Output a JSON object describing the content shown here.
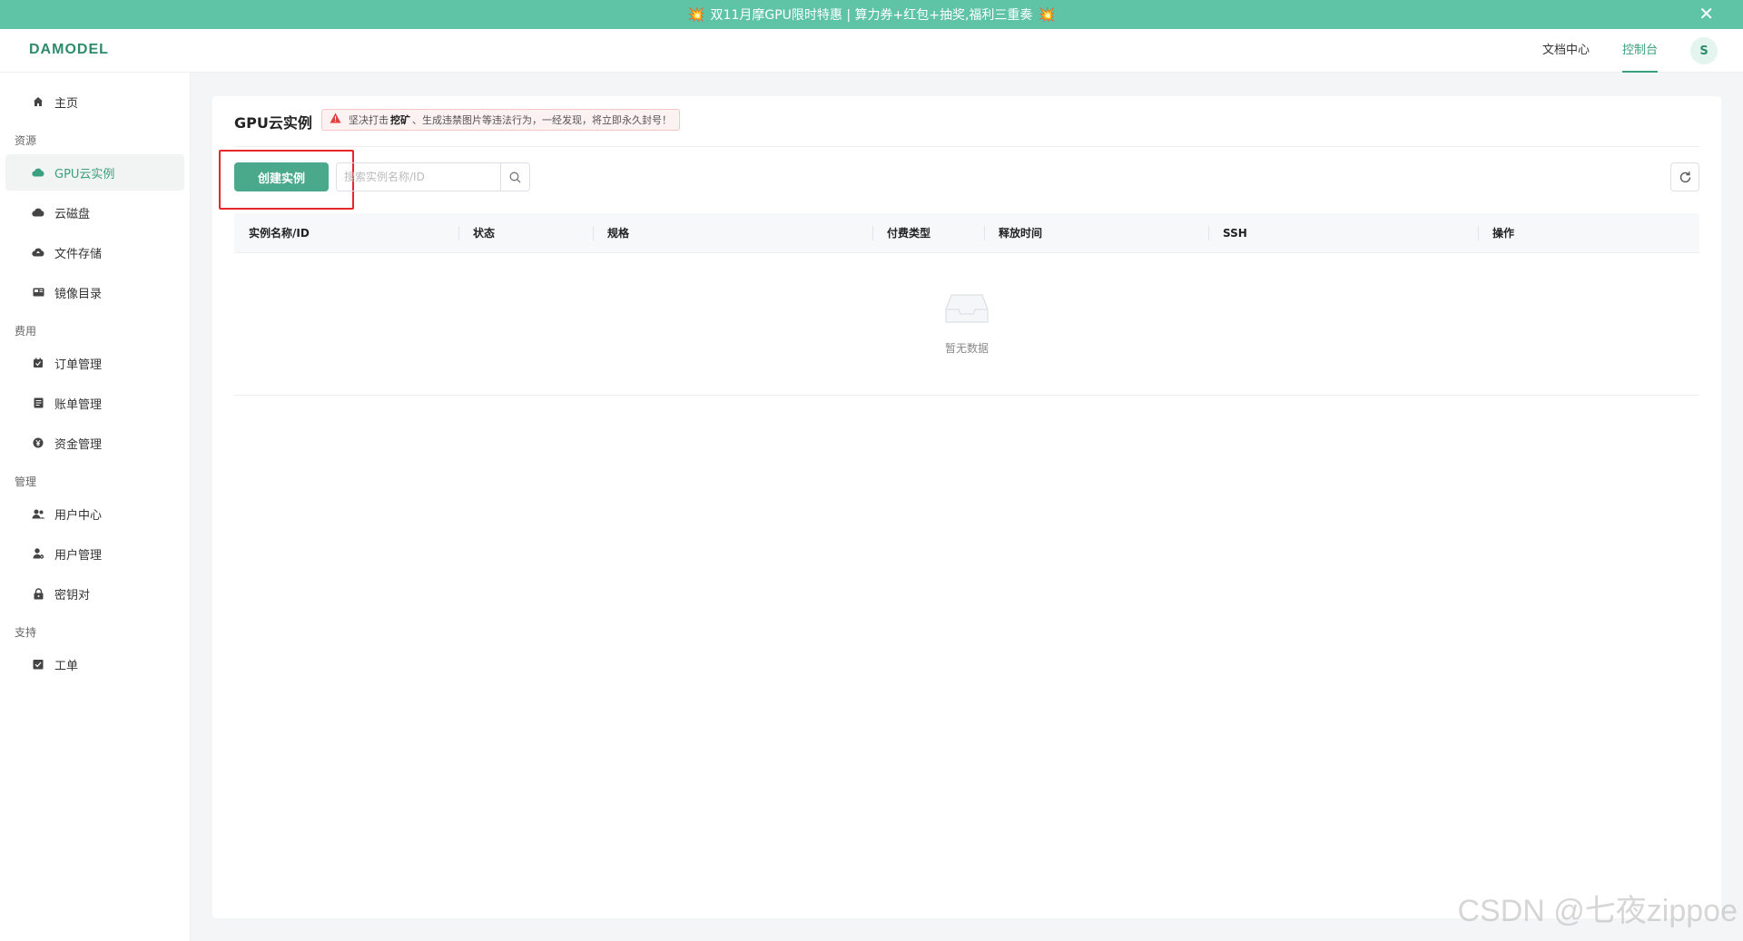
{
  "banner": {
    "text": "双11月摩GPU限时特惠 | 算力券+红包+抽奖,福利三重奏",
    "burst_left": "💥",
    "burst_right": "💥",
    "close_label": "✕"
  },
  "header": {
    "logo": "DAMODEL",
    "nav": [
      {
        "label": "文档中心"
      },
      {
        "label": "控制台"
      }
    ],
    "avatar_letter": "S"
  },
  "sidebar": {
    "home": {
      "label": "主页",
      "icon": "home-icon"
    },
    "groups": [
      {
        "title": "资源",
        "items": [
          {
            "label": "GPU云实例",
            "icon": "cloud-icon",
            "active": true
          },
          {
            "label": "云磁盘",
            "icon": "disk-icon"
          },
          {
            "label": "文件存储",
            "icon": "cloud-upload-icon"
          },
          {
            "label": "镜像目录",
            "icon": "image-icon"
          }
        ]
      },
      {
        "title": "费用",
        "items": [
          {
            "label": "订单管理",
            "icon": "order-icon"
          },
          {
            "label": "账单管理",
            "icon": "bill-icon"
          },
          {
            "label": "资金管理",
            "icon": "yen-icon"
          }
        ]
      },
      {
        "title": "管理",
        "items": [
          {
            "label": "用户中心",
            "icon": "users-icon"
          },
          {
            "label": "用户管理",
            "icon": "user-gear-icon"
          },
          {
            "label": "密钥对",
            "icon": "lock-icon"
          }
        ]
      },
      {
        "title": "支持",
        "items": [
          {
            "label": "工单",
            "icon": "ticket-icon"
          }
        ]
      }
    ]
  },
  "main": {
    "title": "GPU云实例",
    "warning": {
      "prefix": "坚决打击",
      "bold": "挖矿",
      "suffix": "、生成违禁图片等违法行为，一经发现，将立即永久封号！"
    },
    "create_button": "创建实例",
    "search_placeholder": "搜索实例名称/ID",
    "table": {
      "columns": [
        "实例名称/ID",
        "状态",
        "规格",
        "付费类型",
        "释放时间",
        "SSH",
        "操作"
      ],
      "empty_text": "暂无数据"
    }
  },
  "watermark": "CSDN @七夜zippoe",
  "colors": {
    "banner": "#5fc4a6",
    "primary": "#4aa98a",
    "active_text": "#3aa07f",
    "highlight": "#e8262b"
  }
}
